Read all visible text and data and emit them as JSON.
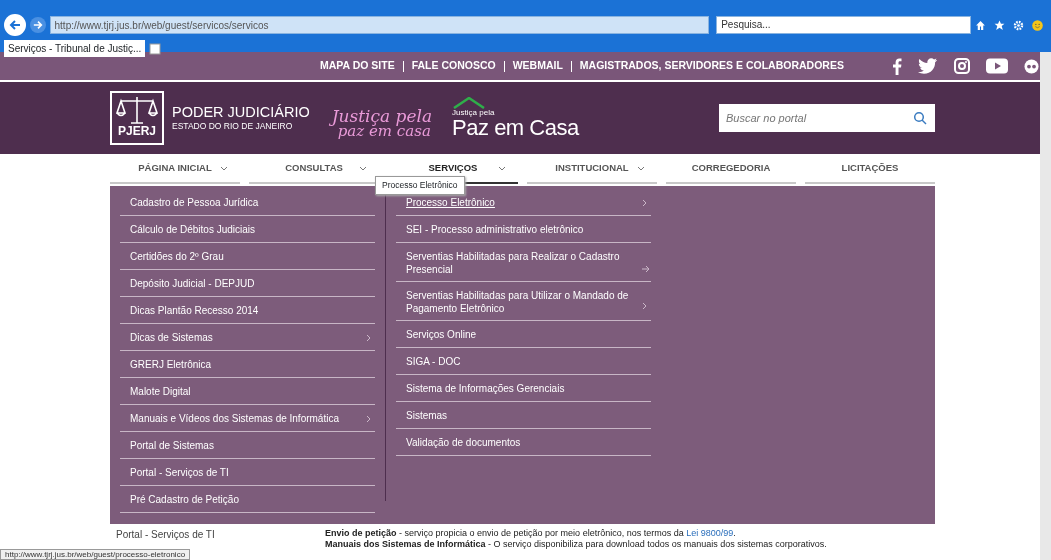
{
  "browser": {
    "address": "http://www.tjrj.jus.br/web/guest/servicos/servicos",
    "search_placeholder": "Pesquisa...",
    "tab_title": "Serviços - Tribunal de Justiç...",
    "status_url": "http://www.tjrj.jus.br/web/guest/processo-eletronico"
  },
  "top_links": [
    "MAPA DO SITE",
    "FALE CONOSCO",
    "WEBMAIL",
    "MAGISTRADOS, SERVIDORES E COLABORADORES"
  ],
  "brand": {
    "logo_text": "PJERJ",
    "title": "PODER JUDICIÁRIO",
    "subtitle": "ESTADO DO RIO DE JANEIRO",
    "campaign_line1": "Justiça pela",
    "campaign_line2": "paz em casa",
    "campaign2_small": "Justiça pela",
    "campaign2_big": "Paz em Casa"
  },
  "search": {
    "placeholder": "Buscar no portal"
  },
  "nav": [
    {
      "label": "PÁGINA INICIAL",
      "dropdown": true,
      "selected": false
    },
    {
      "label": "CONSULTAS",
      "dropdown": true,
      "selected": false
    },
    {
      "label": "SERVIÇOS",
      "dropdown": true,
      "selected": true
    },
    {
      "label": "INSTITUCIONAL",
      "dropdown": true,
      "selected": false
    },
    {
      "label": "CORREGEDORIA",
      "dropdown": false,
      "selected": false
    },
    {
      "label": "LICITAÇÕES",
      "dropdown": false,
      "selected": false
    }
  ],
  "tooltip": "Processo Eletrônico",
  "menu_columns": [
    [
      {
        "label": "Cadastro de Pessoa Jurídica",
        "kind": "link",
        "hovered": false
      },
      {
        "label": "Cálculo de Débitos Judiciais",
        "kind": "link",
        "hovered": false
      },
      {
        "label": "Certidões do 2º Grau",
        "kind": "link",
        "hovered": false
      },
      {
        "label": "Depósito Judicial - DEPJUD",
        "kind": "link",
        "hovered": false
      },
      {
        "label": "Dicas Plantão Recesso 2014",
        "kind": "link",
        "hovered": false
      },
      {
        "label": "Dicas de Sistemas",
        "kind": "submenu",
        "hovered": false
      },
      {
        "label": "GRERJ Eletrônica",
        "kind": "link",
        "hovered": false
      },
      {
        "label": "Malote Digital",
        "kind": "link",
        "hovered": false
      },
      {
        "label": "Manuais e Vídeos dos Sistemas de Informática",
        "kind": "submenu",
        "hovered": false
      },
      {
        "label": "Portal de Sistemas",
        "kind": "link",
        "hovered": false
      },
      {
        "label": "Portal - Serviços de TI",
        "kind": "link",
        "hovered": false
      },
      {
        "label": "Pré Cadastro de Petição",
        "kind": "link",
        "hovered": false
      }
    ],
    [
      {
        "label": "Processo Eletrônico",
        "kind": "submenu",
        "hovered": true
      },
      {
        "label": "SEI - Processo administrativo eletrônico",
        "kind": "link",
        "hovered": false
      },
      {
        "label": "Serventias Habilitadas para Realizar o Cadastro Presencial",
        "kind": "arrow",
        "hovered": false
      },
      {
        "label": "Serventias Habilitadas para Utilizar o Mandado de Pagamento Eletrônico",
        "kind": "submenu",
        "hovered": false
      },
      {
        "label": "Serviços Online",
        "kind": "link",
        "hovered": false
      },
      {
        "label": "SIGA - DOC",
        "kind": "link",
        "hovered": false
      },
      {
        "label": "Sistema de Informações Gerenciais",
        "kind": "link",
        "hovered": false
      },
      {
        "label": "Sistemas",
        "kind": "link",
        "hovered": false
      },
      {
        "label": "Validação de documentos",
        "kind": "link",
        "hovered": false
      }
    ]
  ],
  "below": {
    "side_link": "Portal - Serviços de TI",
    "paragraphs": [
      "**Envio de petição** - serviço propicia o envio de petição por meio eletrônico, nos termos da",
      "**Manuais dos Sistemas de Informática** - O serviço disponibiliza para download todos os manuais dos sistemas corporativos."
    ],
    "law_link": "Lei 9800/99",
    "law_after": "."
  }
}
